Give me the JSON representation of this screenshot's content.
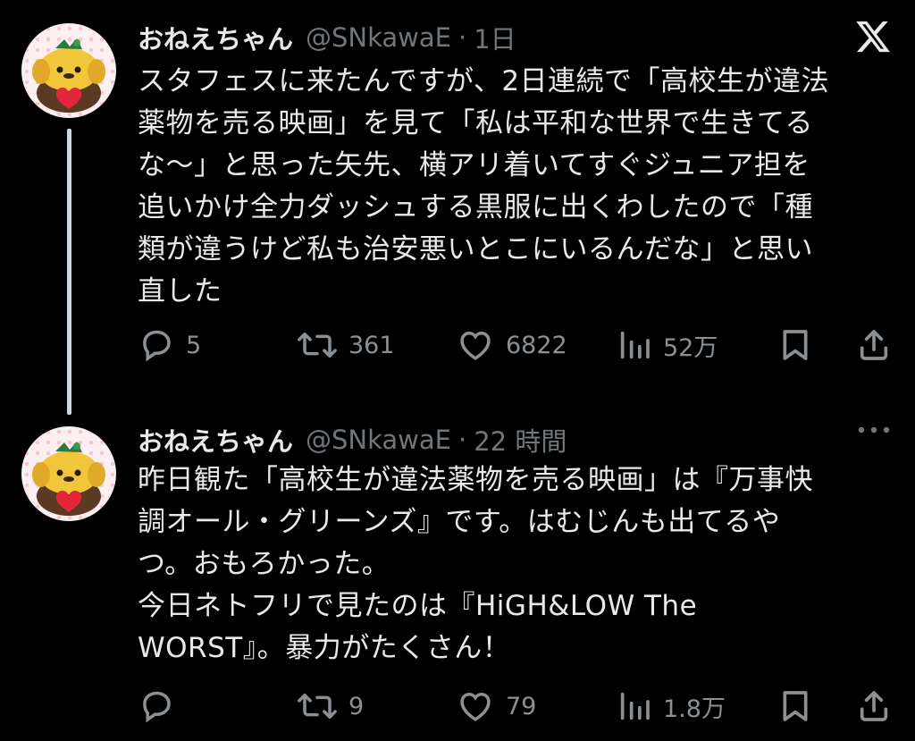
{
  "tweets": [
    {
      "name": "おねえちゃん",
      "handle": "@SNkawaE",
      "separator": "·",
      "time": "1日",
      "body": "スタフェスに来たんですが、2日連続で「高校生が違法\n薬物を売る映画」を見て「私は平和な世界で生きてる\nな〜」と思った矢先、横アリ着いてすぐジュニア担を\n追いかけ全力ダッシュする黒服に出くわしたので「種\n類が違うけど私も治安悪いとこにいるんだな」と思い\n直した",
      "replies": "5",
      "reposts": "361",
      "likes": "6822",
      "views": "52万"
    },
    {
      "name": "おねえちゃん",
      "handle": "@SNkawaE",
      "separator": "·",
      "time": "22 時間",
      "body": "昨日観た「高校生が違法薬物を売る映画」は『万事快\n調オール・グリーンズ』です。はむじんも出てるや\nつ。おもろかった。\n今日ネトフリで見たのは『HiGH&LOW The\nWORST』。暴力がたくさん！",
      "replies": "",
      "reposts": "9",
      "likes": "79",
      "views": "1.8万"
    }
  ],
  "icons": {
    "top_right_first": "x-logo-icon",
    "top_right_second": "more-dots-icon",
    "reply": "reply-bubble-icon",
    "repost": "repost-arrows-icon",
    "like": "heart-icon",
    "views": "views-bars-icon",
    "bookmark": "bookmark-icon",
    "share": "share-upload-icon"
  },
  "colors": {
    "background": "#000000",
    "text": "#e7e9ea",
    "secondary": "#71767b",
    "thread_line": "#cfd9de"
  }
}
